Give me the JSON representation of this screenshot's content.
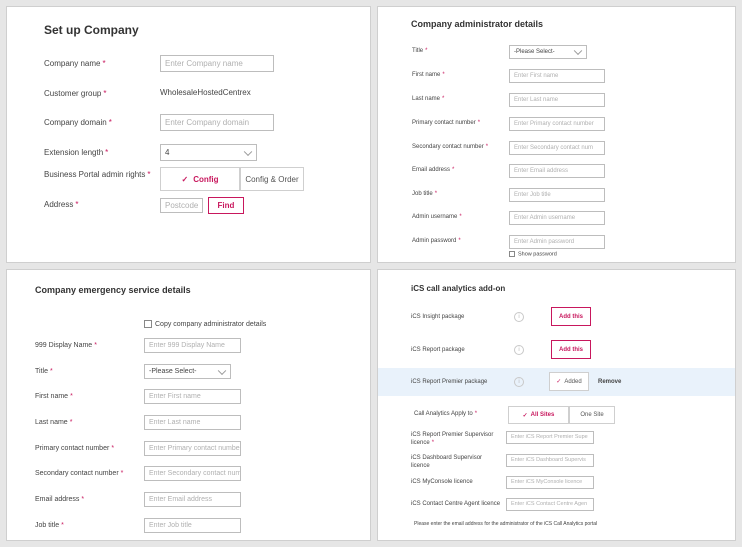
{
  "setup_company": {
    "title": "Set up Company",
    "company_name": {
      "label": "Company name",
      "placeholder": "Enter Company name"
    },
    "customer_group": {
      "label": "Customer group",
      "value": "WholesaleHostedCentrex"
    },
    "company_domain": {
      "label": "Company domain",
      "placeholder": "Enter Company domain"
    },
    "extension_length": {
      "label": "Extension length",
      "value": "4"
    },
    "admin_rights": {
      "label": "Business Portal admin rights",
      "option_config": "Config",
      "option_config_order": "Config & Order"
    },
    "address": {
      "label": "Address",
      "placeholder": "Postcode",
      "find_label": "Find"
    }
  },
  "admin_details": {
    "title": "Company administrator details",
    "title_field": {
      "label": "Title",
      "value": "-Please Select-"
    },
    "first_name": {
      "label": "First name",
      "placeholder": "Enter First name"
    },
    "last_name": {
      "label": "Last name",
      "placeholder": "Enter Last name"
    },
    "primary_contact": {
      "label": "Primary contact number",
      "placeholder": "Enter Primary contact number"
    },
    "secondary_contact": {
      "label": "Secondary contact number",
      "placeholder": "Enter Secondary contact num"
    },
    "email": {
      "label": "Email address",
      "placeholder": "Enter Email address"
    },
    "job_title": {
      "label": "Job title",
      "placeholder": "Enter Job title"
    },
    "admin_username": {
      "label": "Admin username",
      "placeholder": "Enter Admin username"
    },
    "admin_password": {
      "label": "Admin password",
      "placeholder": "Enter Admin password"
    },
    "show_password": "Show password"
  },
  "emergency": {
    "title": "Company emergency service details",
    "copy_label": "Copy company administrator details",
    "display_name": {
      "label": "999 Display Name",
      "placeholder": "Enter 999 Display Name"
    },
    "title_field": {
      "label": "Title",
      "value": "-Please Select-"
    },
    "first_name": {
      "label": "First name",
      "placeholder": "Enter First name"
    },
    "last_name": {
      "label": "Last name",
      "placeholder": "Enter Last name"
    },
    "primary_contact": {
      "label": "Primary contact number",
      "placeholder": "Enter Primary contact number"
    },
    "secondary_contact": {
      "label": "Secondary contact number",
      "placeholder": "Enter Secondary contact num"
    },
    "email": {
      "label": "Email address",
      "placeholder": "Enter Email address"
    },
    "job_title": {
      "label": "Job title",
      "placeholder": "Enter Job title"
    }
  },
  "analytics": {
    "title": "iCS call analytics add-on",
    "insight": {
      "label": "iCS Insight package",
      "button": "Add this"
    },
    "report": {
      "label": "iCS Report package",
      "button": "Add this"
    },
    "premier": {
      "label": "iCS Report Premier package",
      "added": "Added",
      "remove": "Remove"
    },
    "apply_to": {
      "label": "Call Analytics Apply to",
      "all_sites": "All Sites",
      "one_site": "One Site"
    },
    "premier_supervisor": {
      "label_line1": "iCS Report Premier Supervisor",
      "label_line2": "licence",
      "placeholder": "Enter iCS Report Premier Supe"
    },
    "dashboard_supervisor": {
      "label_line1": "iCS Dashboard Supervisor",
      "label_line2": "licence",
      "placeholder": "Enter iCS Dashboard Supervis"
    },
    "myconsole": {
      "label": "iCS MyConsole licence",
      "placeholder": "Enter iCS MyConsole licence"
    },
    "contact_centre": {
      "label": "iCS Contact Centre Agent licence",
      "placeholder": "Enter iCS Contact Centre Agen"
    },
    "footer_note": "Please enter the email address for the administrator of the iCS Call Analytics portal"
  }
}
